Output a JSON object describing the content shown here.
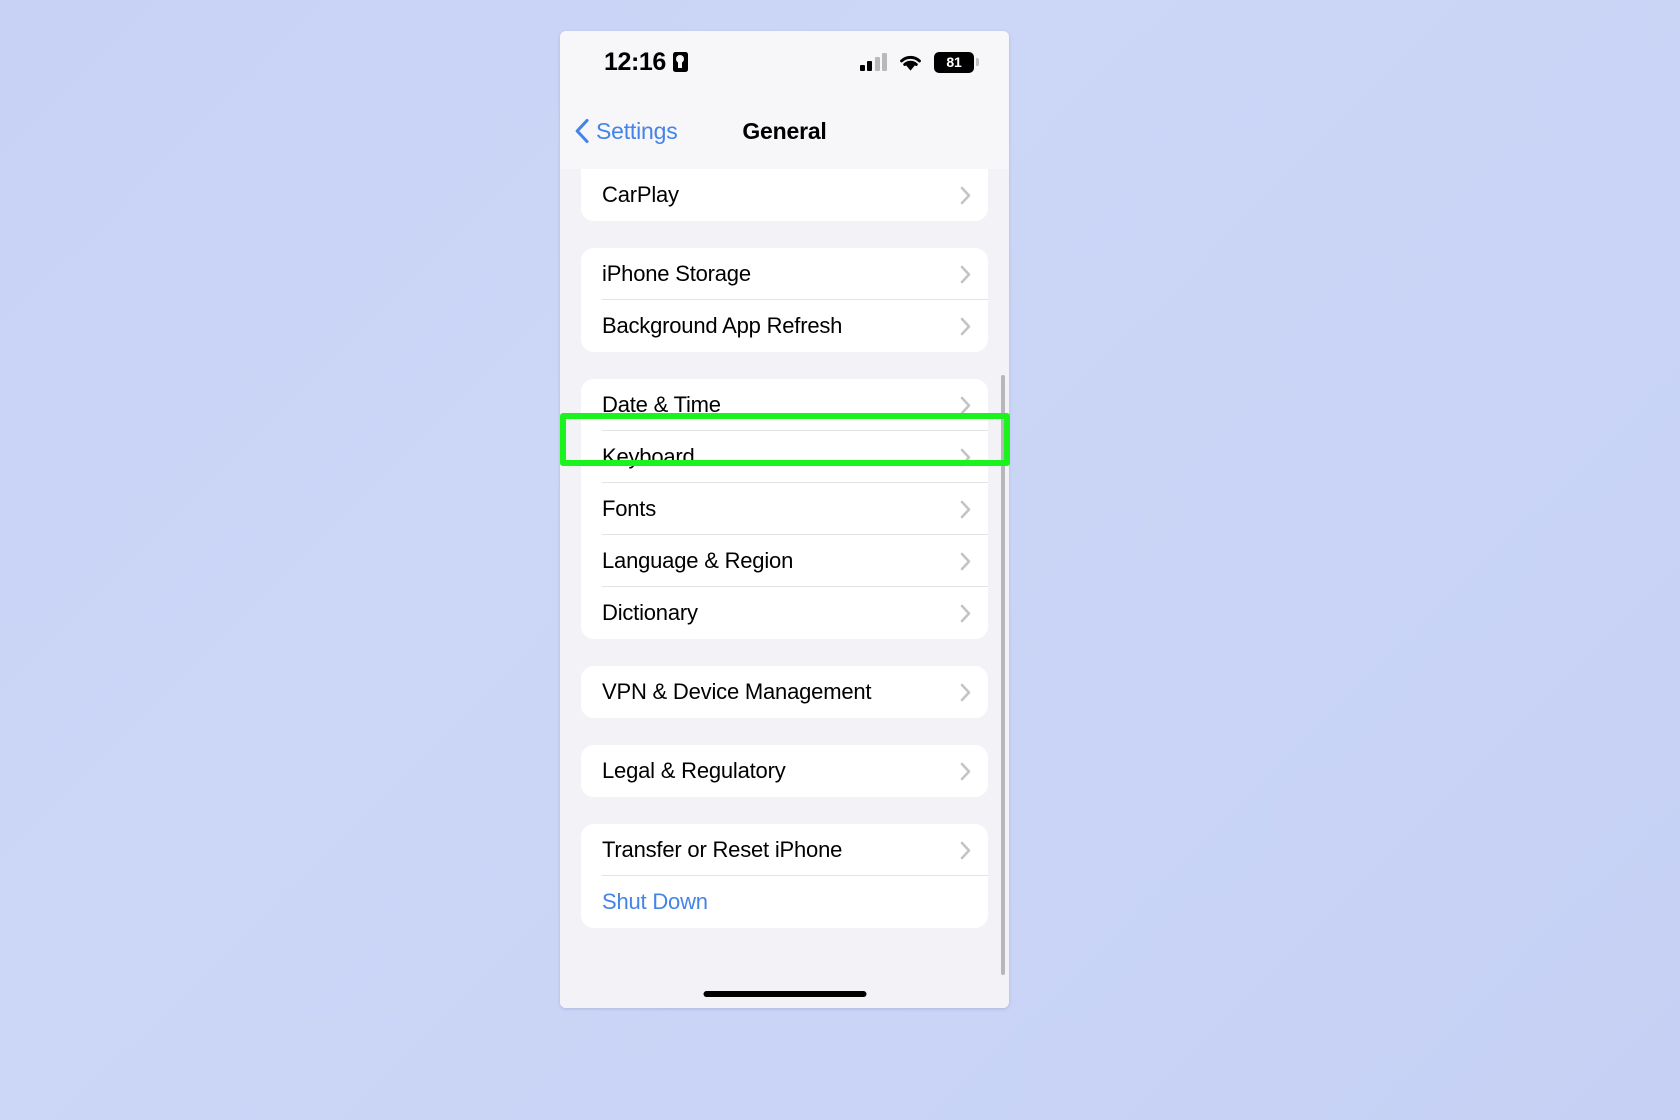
{
  "status_bar": {
    "time": "12:16",
    "lock_icon": "lock-portrait-icon",
    "cellular_icon": "cellular-signal-icon",
    "wifi_icon": "wifi-icon",
    "battery_level": "81"
  },
  "nav": {
    "back_label": "Settings",
    "back_icon": "chevron-left-icon",
    "title": "General"
  },
  "groups": [
    {
      "rows": [
        {
          "label": "CarPlay",
          "accessory": "chevron-right-icon",
          "style": "normal"
        }
      ]
    },
    {
      "rows": [
        {
          "label": "iPhone Storage",
          "accessory": "chevron-right-icon",
          "style": "normal"
        },
        {
          "label": "Background App Refresh",
          "accessory": "chevron-right-icon",
          "style": "normal"
        }
      ]
    },
    {
      "rows": [
        {
          "label": "Date & Time",
          "accessory": "chevron-right-icon",
          "style": "normal"
        },
        {
          "label": "Keyboard",
          "accessory": "chevron-right-icon",
          "style": "normal"
        },
        {
          "label": "Fonts",
          "accessory": "chevron-right-icon",
          "style": "normal"
        },
        {
          "label": "Language & Region",
          "accessory": "chevron-right-icon",
          "style": "normal"
        },
        {
          "label": "Dictionary",
          "accessory": "chevron-right-icon",
          "style": "normal"
        }
      ]
    },
    {
      "rows": [
        {
          "label": "VPN & Device Management",
          "accessory": "chevron-right-icon",
          "style": "normal"
        }
      ]
    },
    {
      "rows": [
        {
          "label": "Legal & Regulatory",
          "accessory": "chevron-right-icon",
          "style": "normal"
        }
      ]
    },
    {
      "rows": [
        {
          "label": "Transfer or Reset iPhone",
          "accessory": "chevron-right-icon",
          "style": "normal"
        },
        {
          "label": "Shut Down",
          "accessory": "none",
          "style": "link"
        }
      ]
    }
  ],
  "annotation": {
    "highlight_target": "Keyboard",
    "highlight_color": "#1cf31c"
  },
  "colors": {
    "accent_blue": "#4484e8",
    "page_background": "#f2f2f7",
    "row_background": "#ffffff",
    "wallpaper": "#c9d4f6"
  }
}
